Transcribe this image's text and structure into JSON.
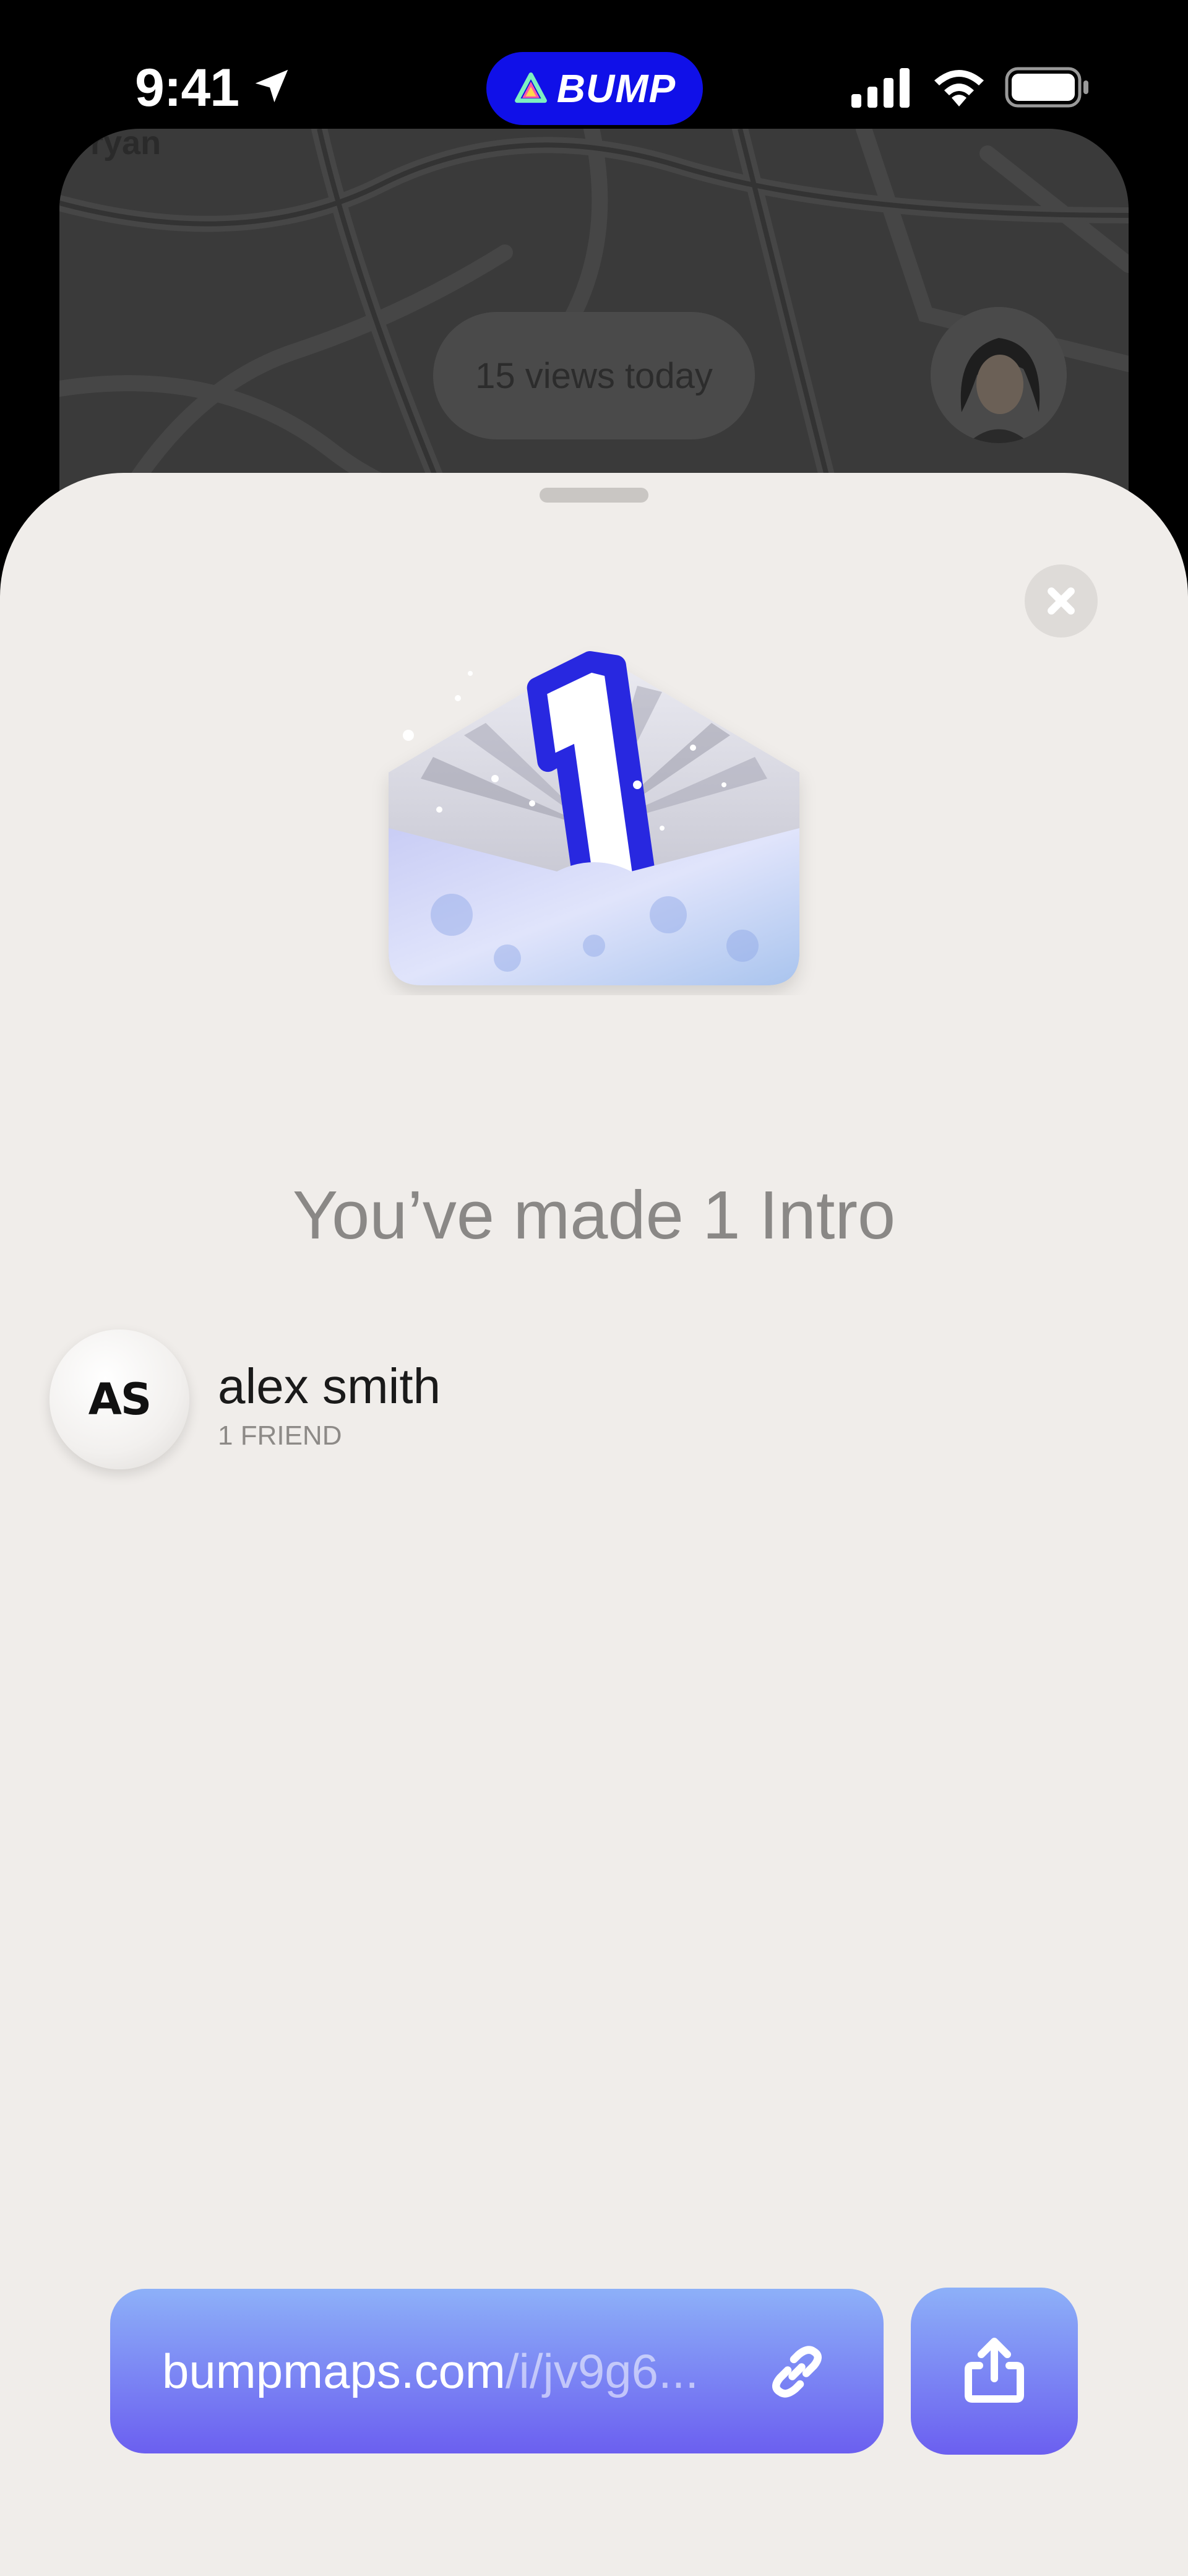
{
  "status_bar": {
    "time": "9:41",
    "app_badge": "BUMP",
    "icons": [
      "location-arrow-icon",
      "bump-logo-icon",
      "cellular-signal-icon",
      "wifi-icon",
      "battery-icon"
    ]
  },
  "background_map": {
    "username_partial": "ryan",
    "views_label": "15 views today"
  },
  "sheet": {
    "headline": "You’ve made 1 Intro",
    "illustration": "open-envelope-number-one",
    "intros": [
      {
        "initials": "AS",
        "name": "alex smith",
        "subtitle": "1 FRIEND"
      }
    ],
    "link": {
      "domain": "bumpmaps.com",
      "path": "/i/jv9g6..."
    },
    "icons": [
      "close-icon",
      "link-icon",
      "share-icon"
    ]
  },
  "colors": {
    "brand_blue": "#1010e8",
    "sheet_background": "#f0edea",
    "button_gradient_top": "#8db0f8",
    "button_gradient_bottom": "#6b5ff0"
  }
}
